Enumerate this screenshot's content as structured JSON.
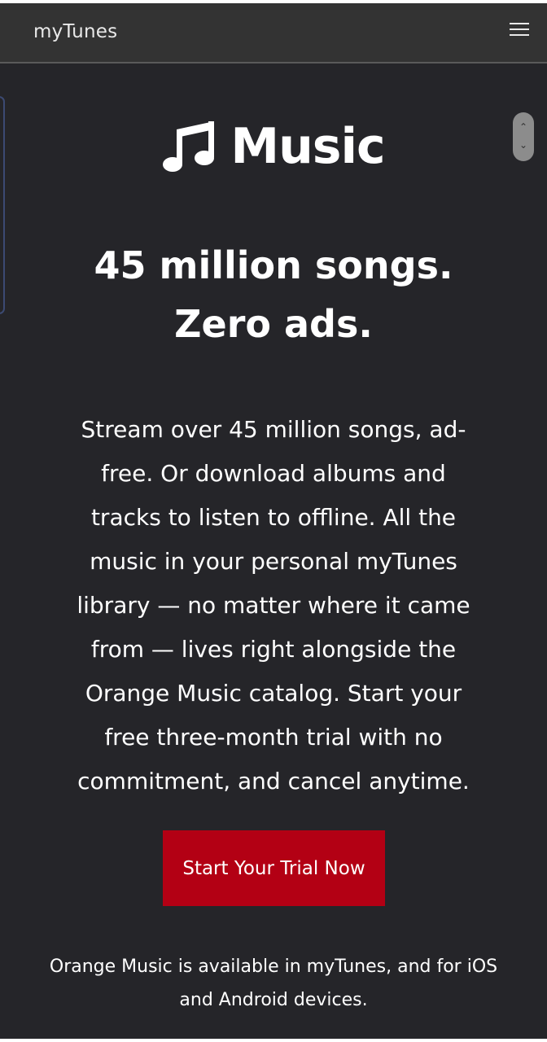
{
  "navbar": {
    "brand": "myTunes",
    "menu_icon": "hamburger-menu-icon"
  },
  "hero": {
    "logo_icon": "music-note-icon",
    "logo_text": "Music",
    "headline": "45 million songs. Zero ads.",
    "description": "Stream over 45 million songs, ad-free. Or download albums and tracks to listen to offline. All the music in your personal myTunes library — no matter where it came from — lives right alongside the Orange Music catalog. Start your free three-month trial with no commitment, and cancel anytime.",
    "cta_label": "Start Your Trial Now",
    "footnote": "Orange Music is available in myTunes, and for iOS and Android devices."
  },
  "colors": {
    "navbar_bg": "#333333",
    "page_bg": "#252529",
    "cta_bg": "#b30014",
    "text": "#ffffff"
  }
}
